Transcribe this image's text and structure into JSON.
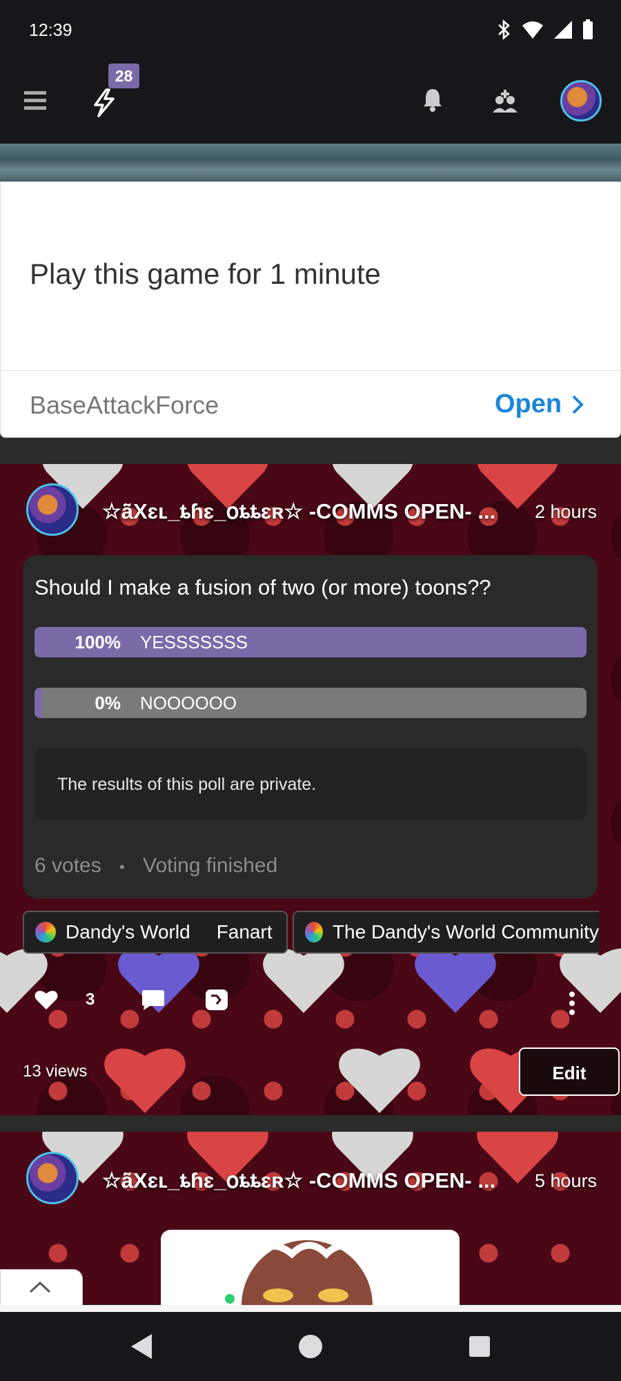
{
  "status_bar": {
    "time": "12:39",
    "icons": [
      "bluetooth-icon",
      "wifi-icon",
      "signal-icon",
      "battery-icon"
    ]
  },
  "header": {
    "badge_count": "28",
    "icons": [
      "menu-icon",
      "lightning-icon",
      "bell-icon",
      "members-icon",
      "avatar"
    ]
  },
  "ad": {
    "title": "Play this game for 1 minute",
    "source": "BaseAttackForce",
    "open_label": "Open"
  },
  "post": {
    "author": "☆ä̃Χɛʟ_ȶɦɛ_օȶȶɛʀ☆ -COMMS OPEN- ...",
    "time": "2 hours",
    "poll": {
      "question": "Should I make a fusion of two (or more) toons??",
      "options": [
        {
          "percent_label": "100%",
          "label": "YESSSSSSS",
          "fraction": 1.0
        },
        {
          "percent_label": "0%",
          "label": "NOOOOOO",
          "fraction": 0.0
        }
      ],
      "private_note": "The results of this poll are private.",
      "votes": "6 votes",
      "status": "Voting finished"
    },
    "tags": [
      {
        "name": "Dandy's World",
        "sub": "Fanart"
      },
      {
        "name": "The Dandy's World Community"
      }
    ],
    "like_count": "3",
    "views": "13 views",
    "edit_label": "Edit"
  },
  "post2": {
    "author": "☆ä̃Χɛʟ_ȶɦɛ_օȶȶɛʀ☆ -COMMS OPEN- ...",
    "time": "5 hours"
  },
  "colors": {
    "accent": "#7a6aa8",
    "link": "#1a86d8",
    "post_background": "#4a0716",
    "header_background": "#16161b"
  }
}
